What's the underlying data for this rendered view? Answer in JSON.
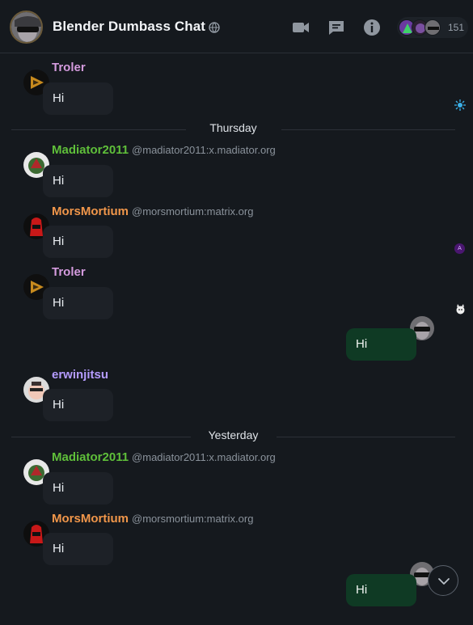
{
  "header": {
    "room_name": "Blender Dumbass Chat",
    "member_count": "151",
    "icons": {
      "public": "globe-icon",
      "call": "video-camera-icon",
      "threads": "threads-icon",
      "info": "info-icon"
    }
  },
  "dividers": [
    "Thursday",
    "Yesterday"
  ],
  "messages": [
    {
      "sender": "Troler",
      "color": "#d49bde",
      "mxid": "",
      "body": "Hi"
    },
    {
      "sender": "Madiator2011",
      "color": "#5fbf3a",
      "mxid": "@madiator2011:x.madiator.org",
      "body": "Hi"
    },
    {
      "sender": "MorsMortium",
      "color": "#f0964a",
      "mxid": "@morsmortium:matrix.org",
      "body": "Hi"
    },
    {
      "sender": "Troler",
      "color": "#d49bde",
      "mxid": "",
      "body": "Hi"
    },
    {
      "sender": "",
      "own": true,
      "body": "Hi"
    },
    {
      "sender": "erwinjitsu",
      "color": "#b59cff",
      "mxid": "",
      "body": "Hi"
    },
    {
      "sender": "Madiator2011",
      "color": "#5fbf3a",
      "mxid": "@madiator2011:x.madiator.org",
      "body": "Hi"
    },
    {
      "sender": "MorsMortium",
      "color": "#f0964a",
      "mxid": "@morsmortium:matrix.org",
      "body": "Hi"
    },
    {
      "sender": "",
      "own": true,
      "body": "Hi"
    }
  ],
  "side_badges": {
    "letter": "A"
  },
  "scroll_button": {
    "icon": "chevron-down-icon"
  }
}
